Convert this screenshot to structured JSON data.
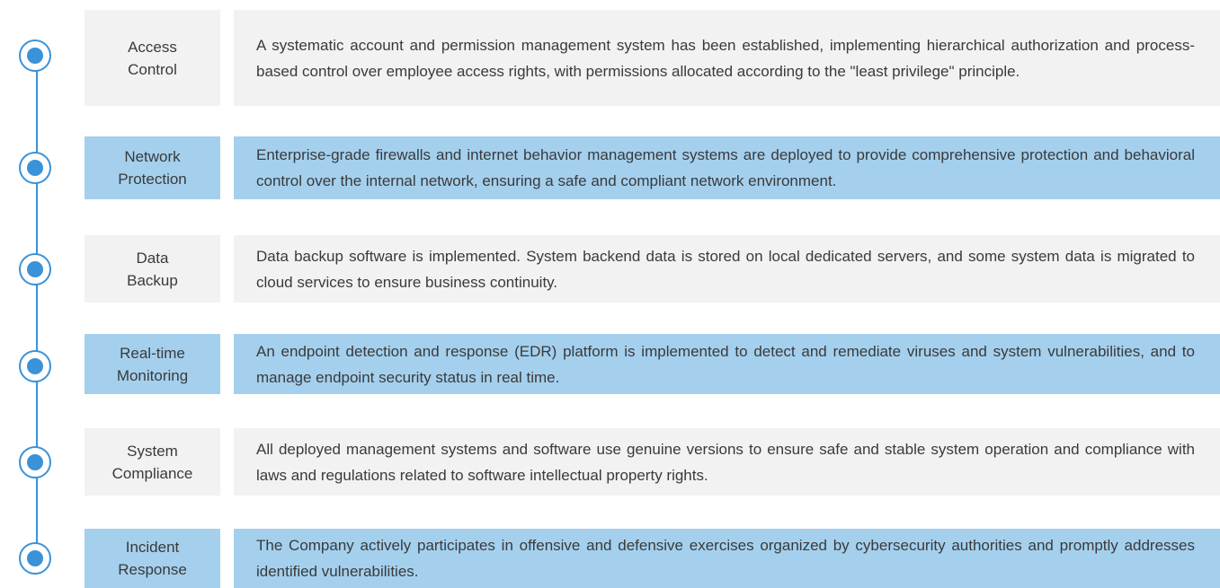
{
  "colors": {
    "accent": "#3a92d8",
    "grey_bg": "#f2f2f2",
    "blue_bg": "#a4d0ee",
    "text": "#3a3a3a"
  },
  "items": [
    {
      "label_lines": [
        "Access",
        "Control"
      ],
      "style": "grey",
      "description": "A systematic account and permission management system has been established, implementing hierarchical authorization and process-based control over employee access rights, with permissions allocated according to the \"least privilege\" principle."
    },
    {
      "label_lines": [
        "Network",
        "Protection"
      ],
      "style": "blue",
      "description": "Enterprise-grade firewalls and internet behavior management systems are deployed to provide comprehensive protection and behavioral control over the internal network, ensuring a safe and compliant network environment."
    },
    {
      "label_lines": [
        "Data",
        "Backup"
      ],
      "style": "grey",
      "description": "Data backup software is implemented. System backend data is stored on local dedicated servers, and some system data is migrated to cloud services to ensure business continuity."
    },
    {
      "label_lines": [
        "Real-time",
        "Monitoring"
      ],
      "style": "blue",
      "description": "An endpoint detection and response (EDR) platform is implemented to detect and remediate viruses and system vulnerabilities, and to manage endpoint security status in real time."
    },
    {
      "label_lines": [
        "System",
        "Compliance"
      ],
      "style": "grey",
      "description": "All deployed management systems and software use genuine versions to ensure safe and stable system operation and compliance with laws and regulations related to software intellectual property rights."
    },
    {
      "label_lines": [
        "Incident",
        "Response"
      ],
      "style": "blue",
      "description": "The Company actively participates in offensive and defensive exercises organized by cybersecurity authorities and promptly addresses identified vulnerabilities."
    }
  ]
}
